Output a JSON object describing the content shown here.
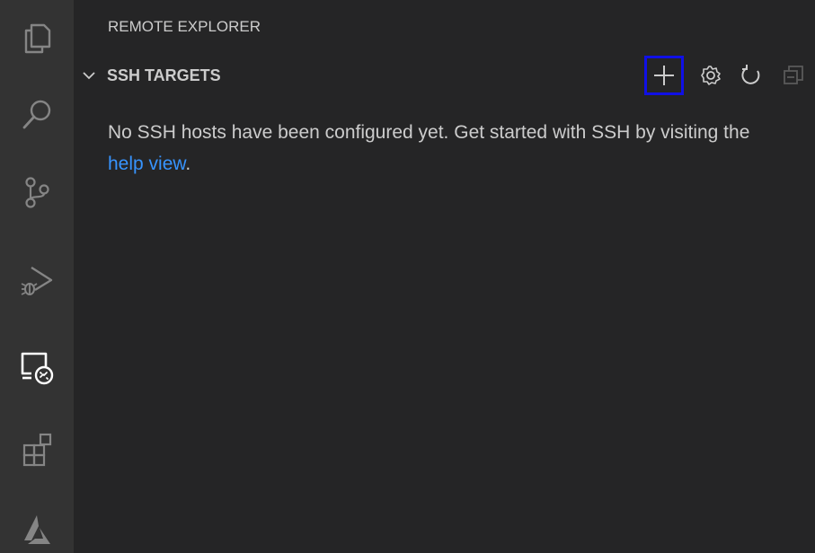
{
  "activity_bar": {
    "items": [
      {
        "name": "explorer",
        "icon": "files-icon"
      },
      {
        "name": "search",
        "icon": "search-icon"
      },
      {
        "name": "source-control",
        "icon": "source-control-icon"
      },
      {
        "name": "run-and-debug",
        "icon": "run-debug-icon"
      },
      {
        "name": "remote-explorer",
        "icon": "remote-explorer-icon",
        "active": true
      },
      {
        "name": "extensions",
        "icon": "extensions-icon"
      },
      {
        "name": "azure",
        "icon": "azure-icon"
      }
    ]
  },
  "view": {
    "title": "REMOTE EXPLORER"
  },
  "section": {
    "title": "SSH TARGETS",
    "expanded": true,
    "actions": [
      {
        "name": "add-new-ssh-host",
        "icon": "add-icon",
        "focused": true
      },
      {
        "name": "configure",
        "icon": "gear-icon"
      },
      {
        "name": "refresh",
        "icon": "refresh-icon"
      },
      {
        "name": "collapse-all",
        "icon": "collapse-all-icon"
      }
    ],
    "message_before": "No SSH hosts have been configured yet. Get started with SSH by visiting the ",
    "link_text": "help view",
    "message_after": "."
  },
  "colors": {
    "activity_bar_bg": "#333333",
    "sidebar_bg": "#252526",
    "foreground": "#cccccc",
    "link": "#3794ff",
    "focus_border": "#1010e6",
    "inactive_icon": "#858585",
    "active_icon": "#ffffff"
  }
}
